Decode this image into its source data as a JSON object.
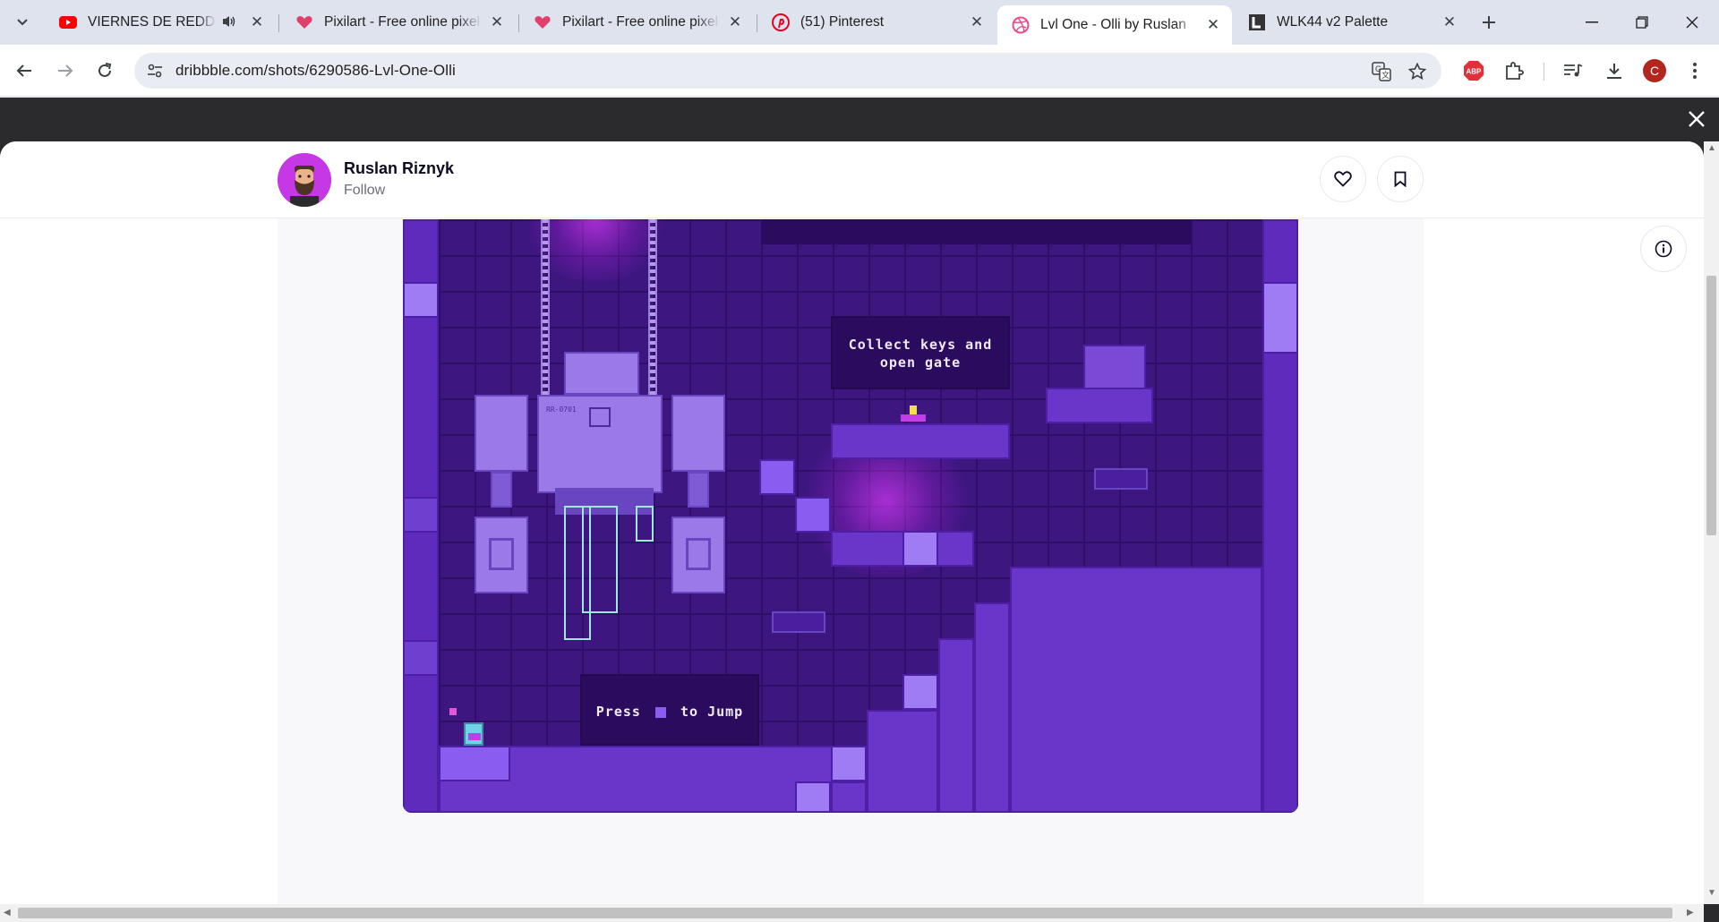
{
  "browser": {
    "tabs": [
      {
        "title": "VIERNES DE REDDIT #",
        "icon": "youtube-icon",
        "audio": true,
        "active": false
      },
      {
        "title": "Pixilart - Free online pixel",
        "icon": "pixilart-heart-icon",
        "active": false
      },
      {
        "title": "Pixilart - Free online pixel",
        "icon": "pixilart-heart-icon",
        "active": false
      },
      {
        "title": "(51) Pinterest",
        "icon": "pinterest-icon",
        "active": false
      },
      {
        "title": "Lvl One - Olli by Ruslan",
        "icon": "dribbble-icon",
        "active": true
      },
      {
        "title": "WLK44 v2 Palette",
        "icon": "lospec-icon",
        "active": false
      }
    ],
    "url": "dribbble.com/shots/6290586-Lvl-One-Olli",
    "profile_initial": "C",
    "extension_abp_label": "ABP"
  },
  "shot": {
    "author_name": "Ruslan Riznyk",
    "follow_label": "Follow"
  },
  "game": {
    "sign_top_line1": "Collect keys and",
    "sign_top_line2": "open gate",
    "sign_bottom_pre": "Press",
    "sign_bottom_post": "to Jump",
    "robot_label": "RR-0701"
  },
  "colors": {
    "accent_avatar": "#c638e6",
    "game_bg": "#3d1680",
    "block": "#6a35c9",
    "glow": "#e13cff"
  }
}
